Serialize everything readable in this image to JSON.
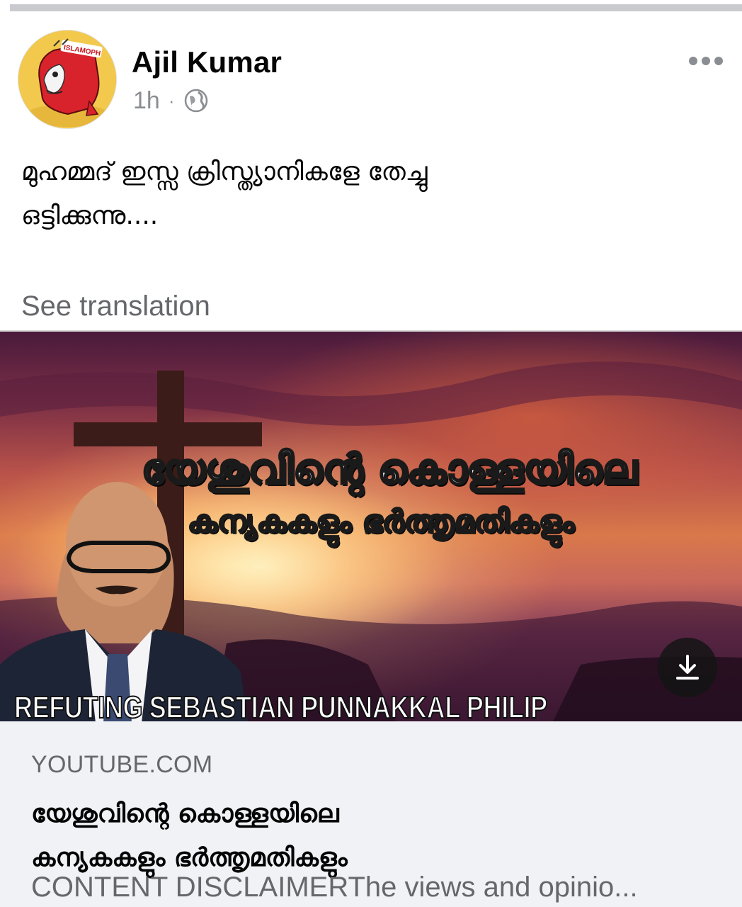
{
  "post": {
    "author": "Ajil Kumar",
    "time": "1h",
    "separator": "·",
    "privacy_icon": "globe-icon",
    "more_icon": "more-horizontal-icon",
    "avatar_text": "ISLAMOPH",
    "text_line1": "മുഹമ്മദ് ഇസ്സ ക്രിസ്ത്യാനികളേ തേച്ചു",
    "text_line2": "ഒട്ടിക്കുന്നു....",
    "see_translation": "See translation"
  },
  "link_card": {
    "thumbnail": {
      "title_line1": "യേശുവിന്റെ കൊള്ളയിലെ",
      "title_line2": "കന്യകകളും ഭർത്തൃമതികളും",
      "caption": "REFUTING SEBASTIAN PUNNAKKAL PHILIP",
      "download_icon": "download-icon"
    },
    "domain": "YOUTUBE.COM",
    "title_line1": "യേശുവിന്റെ കൊള്ളയിലെ",
    "title_line2": "കന്യകകളും ഭർത്തൃമതികളും",
    "description": "CONTENT DISCLAIMERThe views and opinio..."
  },
  "colors": {
    "name": "#050505",
    "secondary": "#65676b",
    "meta": "#8a8d91",
    "card_bg": "#f0f2f5"
  }
}
